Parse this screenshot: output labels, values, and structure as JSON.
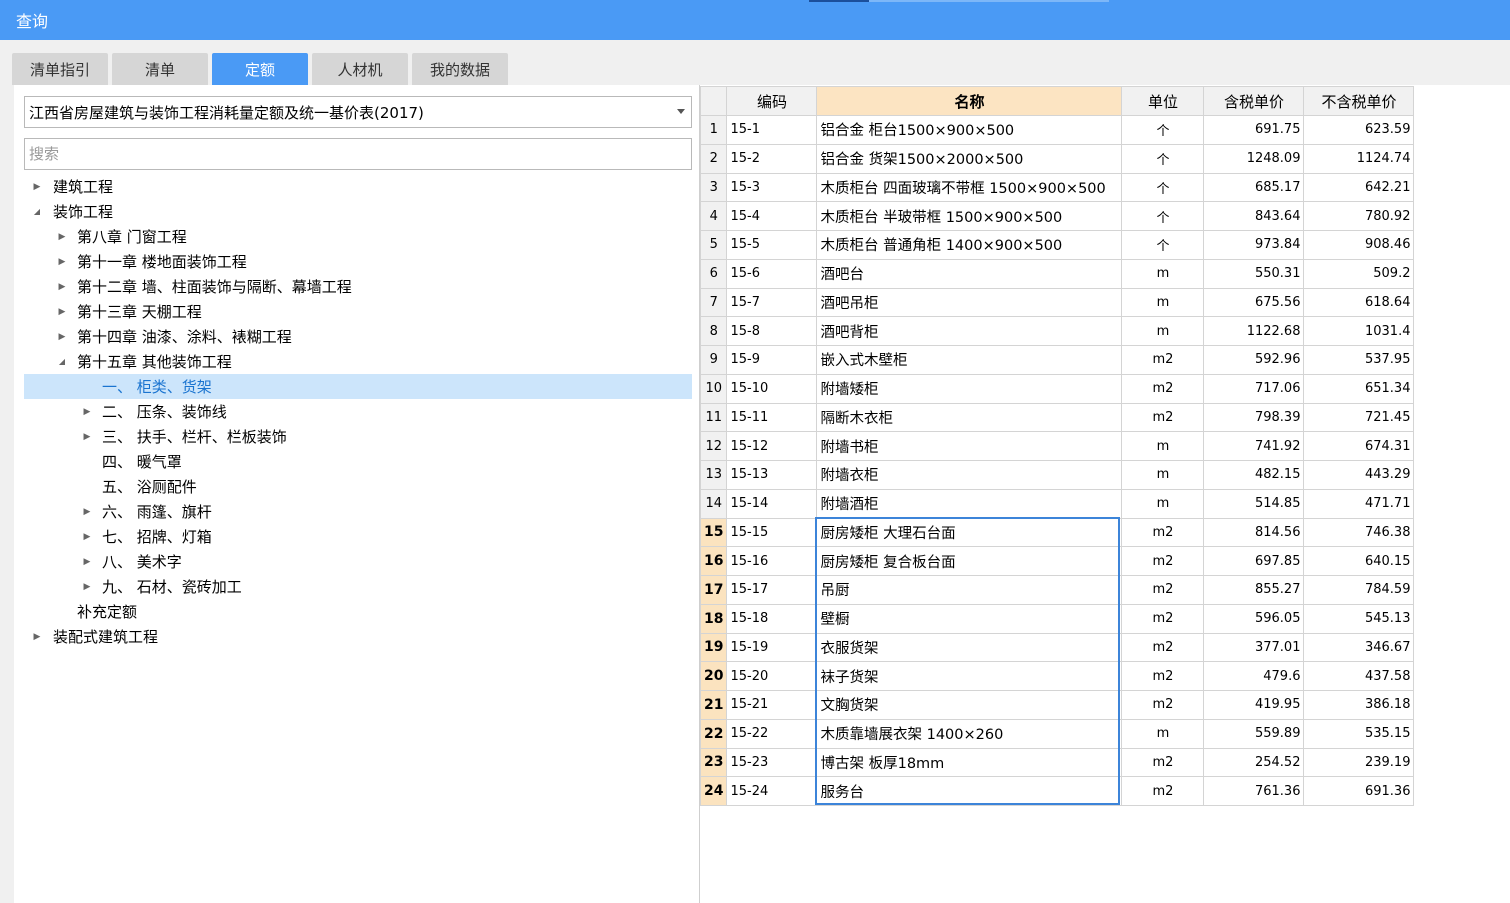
{
  "window": {
    "title": "查询"
  },
  "tabs": [
    {
      "label": "清单指引"
    },
    {
      "label": "清单"
    },
    {
      "label": "定额"
    },
    {
      "label": "人材机"
    },
    {
      "label": "我的数据"
    }
  ],
  "active_tab": "定额",
  "library_select": {
    "value": "江西省房屋建筑与装饰工程消耗量定额及统一基价表(2017)"
  },
  "search": {
    "placeholder": "搜索",
    "value": ""
  },
  "tree": [
    {
      "label": "建筑工程",
      "level": 0,
      "arrow": "collapsed"
    },
    {
      "label": "装饰工程",
      "level": 0,
      "arrow": "expanded"
    },
    {
      "label": "第八章 门窗工程",
      "level": 1,
      "arrow": "collapsed"
    },
    {
      "label": "第十一章 楼地面装饰工程",
      "level": 1,
      "arrow": "collapsed"
    },
    {
      "label": "第十二章 墙、柱面装饰与隔断、幕墙工程",
      "level": 1,
      "arrow": "collapsed"
    },
    {
      "label": "第十三章 天棚工程",
      "level": 1,
      "arrow": "collapsed"
    },
    {
      "label": "第十四章 油漆、涂料、裱糊工程",
      "level": 1,
      "arrow": "collapsed"
    },
    {
      "label": "第十五章 其他装饰工程",
      "level": 1,
      "arrow": "expanded"
    },
    {
      "label": "一、 柜类、货架",
      "level": 2,
      "arrow": "none",
      "selected": true
    },
    {
      "label": "二、 压条、装饰线",
      "level": 2,
      "arrow": "collapsed"
    },
    {
      "label": "三、 扶手、栏杆、栏板装饰",
      "level": 2,
      "arrow": "collapsed"
    },
    {
      "label": "四、 暖气罩",
      "level": 2,
      "arrow": "none"
    },
    {
      "label": "五、 浴厕配件",
      "level": 2,
      "arrow": "none"
    },
    {
      "label": "六、 雨篷、旗杆",
      "level": 2,
      "arrow": "collapsed"
    },
    {
      "label": "七、 招牌、灯箱",
      "level": 2,
      "arrow": "collapsed"
    },
    {
      "label": "八、 美术字",
      "level": 2,
      "arrow": "collapsed"
    },
    {
      "label": "九、 石材、瓷砖加工",
      "level": 2,
      "arrow": "collapsed"
    },
    {
      "label": "补充定额",
      "level": 1,
      "arrow": "none"
    },
    {
      "label": "装配式建筑工程",
      "level": 0,
      "arrow": "collapsed"
    }
  ],
  "table": {
    "headers": [
      "编码",
      "名称",
      "单位",
      "含税单价",
      "不含税单价"
    ],
    "rows": [
      {
        "no": "1",
        "code": "15-1",
        "name": "铝合金 柜台1500×900×500",
        "unit": "个",
        "price_tax": "691.75",
        "price_notax": "623.59"
      },
      {
        "no": "2",
        "code": "15-2",
        "name": "铝合金 货架1500×2000×500",
        "unit": "个",
        "price_tax": "1248.09",
        "price_notax": "1124.74"
      },
      {
        "no": "3",
        "code": "15-3",
        "name": "木质柜台 四面玻璃不带框 1500×900×500",
        "unit": "个",
        "price_tax": "685.17",
        "price_notax": "642.21"
      },
      {
        "no": "4",
        "code": "15-4",
        "name": "木质柜台 半玻带框 1500×900×500",
        "unit": "个",
        "price_tax": "843.64",
        "price_notax": "780.92"
      },
      {
        "no": "5",
        "code": "15-5",
        "name": "木质柜台 普通角柜 1400×900×500",
        "unit": "个",
        "price_tax": "973.84",
        "price_notax": "908.46"
      },
      {
        "no": "6",
        "code": "15-6",
        "name": "酒吧台",
        "unit": "m",
        "price_tax": "550.31",
        "price_notax": "509.2"
      },
      {
        "no": "7",
        "code": "15-7",
        "name": "酒吧吊柜",
        "unit": "m",
        "price_tax": "675.56",
        "price_notax": "618.64"
      },
      {
        "no": "8",
        "code": "15-8",
        "name": "酒吧背柜",
        "unit": "m",
        "price_tax": "1122.68",
        "price_notax": "1031.4"
      },
      {
        "no": "9",
        "code": "15-9",
        "name": "嵌入式木壁柜",
        "unit": "m2",
        "price_tax": "592.96",
        "price_notax": "537.95"
      },
      {
        "no": "10",
        "code": "15-10",
        "name": "附墙矮柜",
        "unit": "m2",
        "price_tax": "717.06",
        "price_notax": "651.34"
      },
      {
        "no": "11",
        "code": "15-11",
        "name": "隔断木衣柜",
        "unit": "m2",
        "price_tax": "798.39",
        "price_notax": "721.45"
      },
      {
        "no": "12",
        "code": "15-12",
        "name": "附墙书柜",
        "unit": "m",
        "price_tax": "741.92",
        "price_notax": "674.31"
      },
      {
        "no": "13",
        "code": "15-13",
        "name": "附墙衣柜",
        "unit": "m",
        "price_tax": "482.15",
        "price_notax": "443.29"
      },
      {
        "no": "14",
        "code": "15-14",
        "name": "附墙酒柜",
        "unit": "m",
        "price_tax": "514.85",
        "price_notax": "471.71"
      },
      {
        "no": "15",
        "code": "15-15",
        "name": "厨房矮柜 大理石台面",
        "unit": "m2",
        "price_tax": "814.56",
        "price_notax": "746.38"
      },
      {
        "no": "16",
        "code": "15-16",
        "name": "厨房矮柜 复合板台面",
        "unit": "m2",
        "price_tax": "697.85",
        "price_notax": "640.15"
      },
      {
        "no": "17",
        "code": "15-17",
        "name": "吊厨",
        "unit": "m2",
        "price_tax": "855.27",
        "price_notax": "784.59"
      },
      {
        "no": "18",
        "code": "15-18",
        "name": "壁橱",
        "unit": "m2",
        "price_tax": "596.05",
        "price_notax": "545.13"
      },
      {
        "no": "19",
        "code": "15-19",
        "name": "衣服货架",
        "unit": "m2",
        "price_tax": "377.01",
        "price_notax": "346.67"
      },
      {
        "no": "20",
        "code": "15-20",
        "name": "袜子货架",
        "unit": "m2",
        "price_tax": "479.6",
        "price_notax": "437.58"
      },
      {
        "no": "21",
        "code": "15-21",
        "name": "文胸货架",
        "unit": "m2",
        "price_tax": "419.95",
        "price_notax": "386.18"
      },
      {
        "no": "22",
        "code": "15-22",
        "name": "木质靠墙展衣架 1400×260",
        "unit": "m",
        "price_tax": "559.89",
        "price_notax": "535.15"
      },
      {
        "no": "23",
        "code": "15-23",
        "name": "博古架 板厚18mm",
        "unit": "m2",
        "price_tax": "254.52",
        "price_notax": "239.19"
      },
      {
        "no": "24",
        "code": "15-24",
        "name": "服务台",
        "unit": "m2",
        "price_tax": "761.36",
        "price_notax": "691.36"
      }
    ]
  },
  "colors": {
    "accent": "#4a9af5",
    "selection": "#cce5fb",
    "header_highlight": "#fce4c2"
  }
}
